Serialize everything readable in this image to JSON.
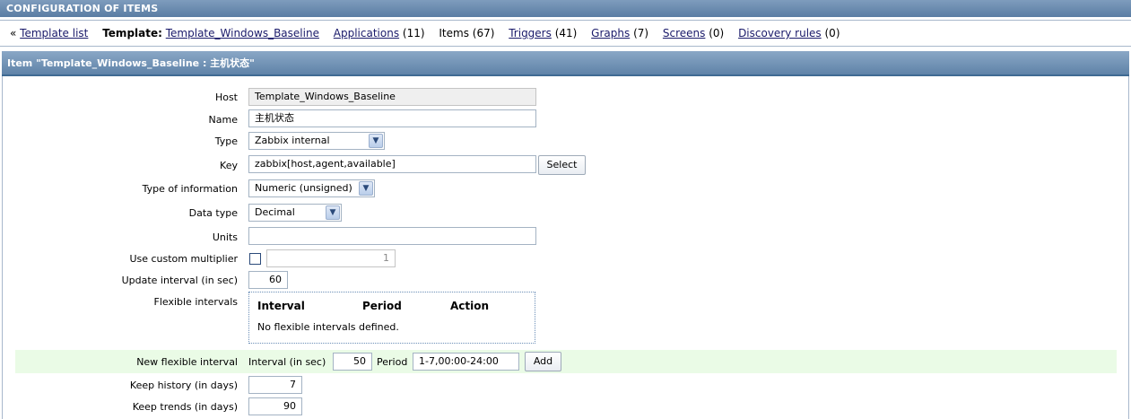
{
  "header": {
    "title": "CONFIGURATION OF ITEMS"
  },
  "nav": {
    "prefix": "«",
    "template_list": "Template list",
    "template_label": "Template:",
    "template_name": "Template_Windows_Baseline",
    "applications": "Applications",
    "applications_count": "(11)",
    "items": "Items (67)",
    "triggers": "Triggers",
    "triggers_count": "(41)",
    "graphs": "Graphs",
    "graphs_count": "(7)",
    "screens": "Screens",
    "screens_count": "(0)",
    "discovery": "Discovery rules",
    "discovery_count": "(0)"
  },
  "form": {
    "title": "Item \"Template_Windows_Baseline : 主机状态\"",
    "host_label": "Host",
    "host_value": "Template_Windows_Baseline",
    "name_label": "Name",
    "name_value": "主机状态",
    "type_label": "Type",
    "type_value": "Zabbix internal",
    "key_label": "Key",
    "key_value": "zabbix[host,agent,available]",
    "select_button": "Select",
    "type_info_label": "Type of information",
    "type_info_value": "Numeric (unsigned)",
    "data_type_label": "Data type",
    "data_type_value": "Decimal",
    "units_label": "Units",
    "units_value": "",
    "multiplier_label": "Use custom multiplier",
    "multiplier_value": "1",
    "multiplier_checked": false,
    "update_label": "Update interval (in sec)",
    "update_value": "60",
    "flex_label": "Flexible intervals",
    "flex_headers": [
      "Interval",
      "Period",
      "Action"
    ],
    "flex_empty": "No flexible intervals defined.",
    "new_flex_label": "New flexible interval",
    "interval_label": "Interval (in sec)",
    "interval_value": "50",
    "period_label": "Period",
    "period_value": "1-7,00:00-24:00",
    "add_button": "Add",
    "history_label": "Keep history (in days)",
    "history_value": "7",
    "trends_label": "Keep trends (in days)",
    "trends_value": "90"
  }
}
